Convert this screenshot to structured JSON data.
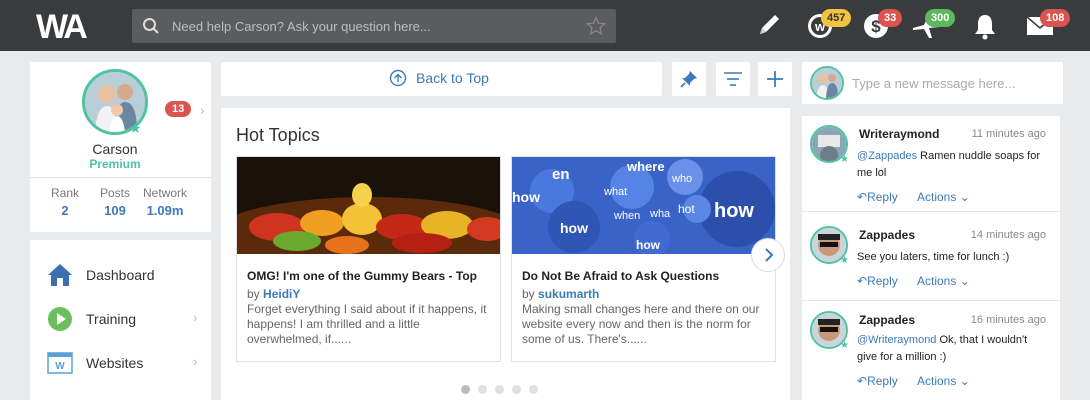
{
  "topbar": {
    "search_placeholder": "Need help Carson? Ask your question here...",
    "badges": {
      "wealthy_credits": "457",
      "dollar": "33",
      "flights": "300",
      "mail": "108"
    }
  },
  "profile": {
    "name": "Carson",
    "membership": "Premium",
    "notifications": "13",
    "stats": [
      {
        "label": "Rank",
        "value": "2"
      },
      {
        "label": "Posts",
        "value": "109"
      },
      {
        "label": "Network",
        "value": "1.09m"
      }
    ]
  },
  "nav": {
    "items": [
      {
        "label": "Dashboard",
        "icon": "home-icon"
      },
      {
        "label": "Training",
        "icon": "play-icon"
      },
      {
        "label": "Websites",
        "icon": "websites-icon"
      }
    ]
  },
  "center": {
    "back_to_top": "Back to Top",
    "hot_topics_title": "Hot Topics",
    "topics": [
      {
        "title": "OMG! I'm one of the Gummy Bears - Top",
        "by_prefix": "by",
        "author": "HeidiY",
        "excerpt": "Forget everything I said about if it happens, it happens! I am thrilled and a little overwhelmed, if......"
      },
      {
        "title": "Do Not Be Afraid to Ask Questions",
        "by_prefix": "by",
        "author": "sukumarth",
        "excerpt": "Making small changes here and there on our website every now and then is the norm for some of us. There's......"
      }
    ],
    "image2_words": [
      "where",
      "en",
      "who",
      "what",
      "how",
      "when",
      "wha",
      "hot",
      "how",
      "how",
      "how"
    ]
  },
  "right": {
    "message_placeholder": "Type a new message here...",
    "posts": [
      {
        "author": "Writeraymond",
        "time": "11 minutes ago",
        "mention": "@Zappades",
        "text": "Ramen nuddle soaps for me lol",
        "reply": "Reply",
        "actions": "Actions"
      },
      {
        "author": "Zappades",
        "time": "14 minutes ago",
        "mention": "",
        "text": "See you laters, time for lunch :)",
        "reply": "Reply",
        "actions": "Actions"
      },
      {
        "author": "Zappades",
        "time": "16 minutes ago",
        "mention": "@Writeraymond",
        "text": "Ok, that I wouldn't give for a million :)",
        "reply": "Reply",
        "actions": "Actions"
      }
    ]
  },
  "colors": {
    "accent_blue": "#3c7ab9",
    "accent_green": "#4fc3a1",
    "topbar": "#3a3b3d",
    "badge_red": "#d9534f"
  }
}
